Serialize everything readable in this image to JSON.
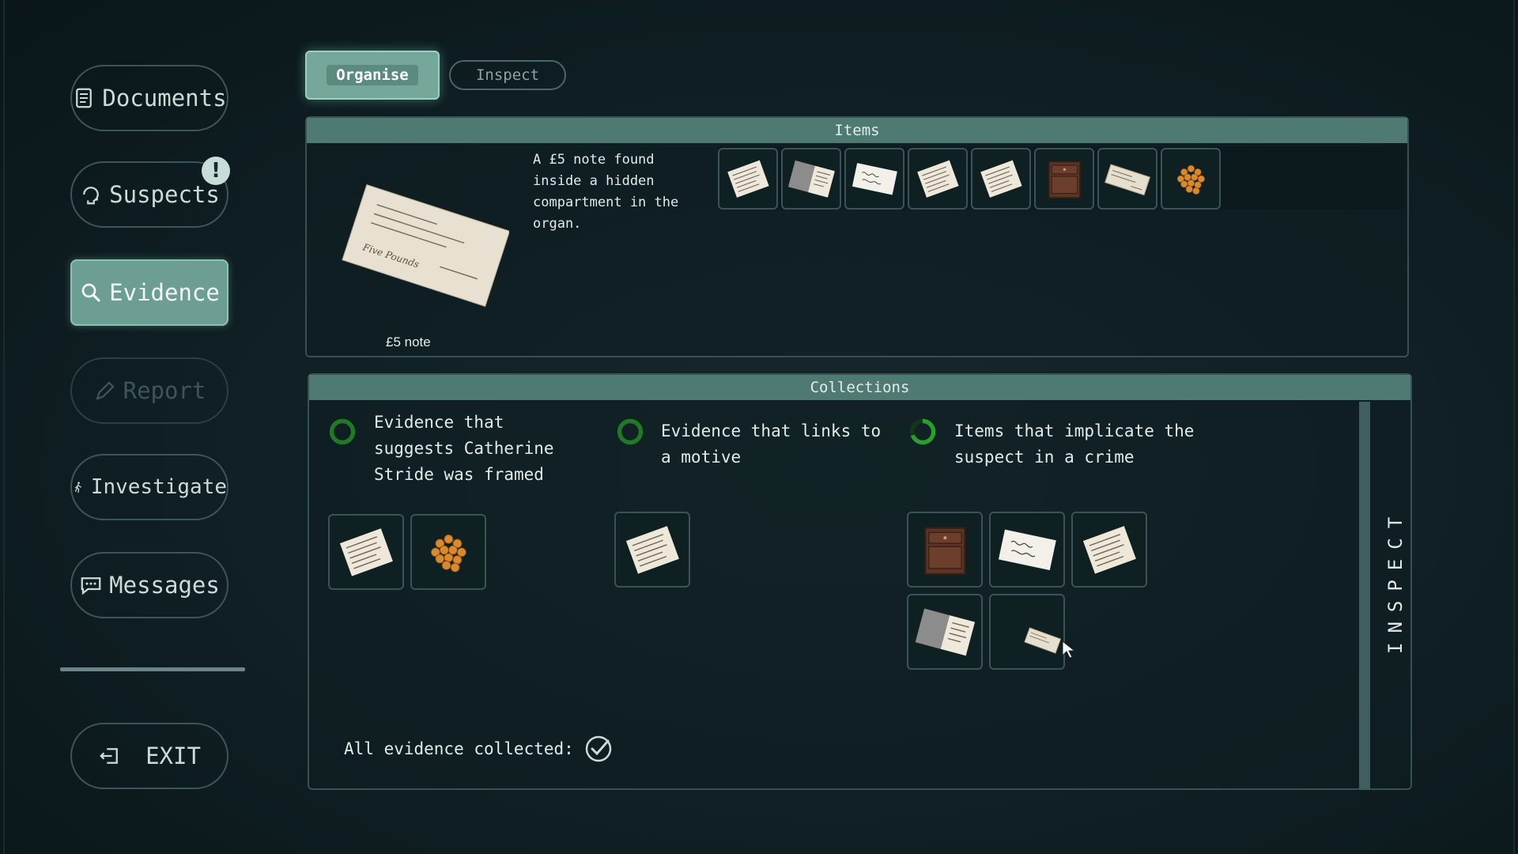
{
  "sidebar": {
    "documents": "Documents",
    "suspects": "Suspects",
    "suspects_badge": "!",
    "evidence": "Evidence",
    "report": "Report",
    "investigate": "Investigate",
    "messages": "Messages",
    "exit": "EXIT"
  },
  "tabs": {
    "organise": "Organise",
    "inspect": "Inspect"
  },
  "items": {
    "header": "Items",
    "selected_name": "£5 note",
    "description": "A £5 note found inside a hidden compartment in the organ.",
    "thumbnails": [
      "letter",
      "open-book",
      "handwritten-card",
      "letter",
      "letter",
      "cabinet",
      "banknote",
      "orange-pile"
    ]
  },
  "collections": {
    "header": "Collections",
    "groups": [
      {
        "title": "Evidence that suggests Catherine Stride was framed",
        "icons": [
          "letter",
          "orange-pile"
        ]
      },
      {
        "title": "Evidence that links to a motive",
        "icons": [
          "letter"
        ]
      },
      {
        "title": "Items that implicate the suspect in a crime",
        "icons": [
          "cabinet",
          "handwritten-card",
          "letter",
          "open-book",
          "banknote-dragging"
        ]
      }
    ],
    "all_collected_label": "All evidence collected:",
    "inspect_label": "INSPECT"
  },
  "colors": {
    "accent": "#6d9e93",
    "ring": "#1f7a24",
    "panel_head": "#4f7a73"
  }
}
